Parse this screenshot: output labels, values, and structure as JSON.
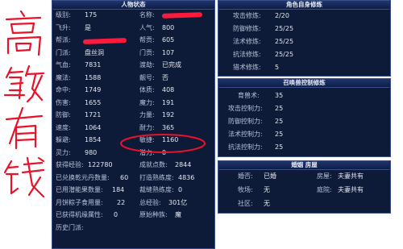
{
  "char_panel": {
    "title": "人物状态",
    "left": [
      {
        "label": "级别:",
        "value": "175"
      },
      {
        "label": "飞升:",
        "value": "是"
      },
      {
        "label": "帮派:",
        "value": ""
      },
      {
        "label": "门派:",
        "value": "盘丝洞"
      },
      {
        "label": "气血:",
        "value": "7831"
      },
      {
        "label": "魔法:",
        "value": "1588"
      },
      {
        "label": "命中:",
        "value": "1749"
      },
      {
        "label": "伤害:",
        "value": "1655"
      },
      {
        "label": "防御:",
        "value": "1721"
      },
      {
        "label": "速度:",
        "value": "1064"
      },
      {
        "label": "躲避:",
        "value": "1854"
      },
      {
        "label": "灵力:",
        "value": "980"
      },
      {
        "label": "获得经验:",
        "value": "122780"
      },
      {
        "label": "已兑换乾元丹数量:",
        "value": "60"
      },
      {
        "label": "已用潜能果数量:",
        "value": "184"
      },
      {
        "label": "月饼粽子食用量:",
        "value": "22"
      },
      {
        "label": "已获得机缘属性:",
        "value": "0"
      },
      {
        "label": "历史门派:",
        "value": ""
      }
    ],
    "right": [
      {
        "label": "名称:",
        "value": ""
      },
      {
        "label": "人气:",
        "value": "800"
      },
      {
        "label": "帮贡:",
        "value": "605"
      },
      {
        "label": "门贡:",
        "value": "107"
      },
      {
        "label": "渡劫:",
        "value": "已完成"
      },
      {
        "label": "靓号:",
        "value": "否"
      },
      {
        "label": "体质:",
        "value": "408"
      },
      {
        "label": "魔力:",
        "value": "191"
      },
      {
        "label": "力量:",
        "value": "192"
      },
      {
        "label": "耐力:",
        "value": "365"
      },
      {
        "label": "敏捷:",
        "value": "1160"
      },
      {
        "label": "潜力:",
        "value": "0"
      },
      {
        "label": "成就点数:",
        "value": "2844"
      },
      {
        "label": "打造熟练度:",
        "value": "4836"
      },
      {
        "label": "裁缝熟练度:",
        "value": "0"
      },
      {
        "label": "总经验:",
        "value": "301亿"
      },
      {
        "label": "原始种族:",
        "value": "魔"
      }
    ]
  },
  "self_cultivation": {
    "title": "角色自身修炼",
    "rows": [
      {
        "label": "攻击修炼:",
        "value": "2/20"
      },
      {
        "label": "防御修炼:",
        "value": "25/25"
      },
      {
        "label": "法术修炼:",
        "value": "25/25"
      },
      {
        "label": "抗法修炼:",
        "value": "25/25"
      },
      {
        "label": "猎术修炼:",
        "value": "5"
      }
    ]
  },
  "pet_control": {
    "title": "召唤兽控制修炼",
    "rows": [
      {
        "label": "育兽术:",
        "value": "35"
      },
      {
        "label": "攻击控制力:",
        "value": "25"
      },
      {
        "label": "防御控制力:",
        "value": "25"
      },
      {
        "label": "法术控制力:",
        "value": "25"
      },
      {
        "label": "抗法控制力:",
        "value": "25"
      }
    ]
  },
  "marriage": {
    "title": "婚姻 房屋",
    "rows": [
      [
        {
          "label": "婚否:",
          "value": "已婚"
        },
        {
          "label": "房屋:",
          "value": "夫妻共有"
        }
      ],
      [
        {
          "label": "牧场:",
          "value": "无"
        },
        {
          "label": "庭院:",
          "value": "夫妻共有"
        }
      ],
      [
        {
          "label": "社区:",
          "value": "无"
        }
      ]
    ]
  },
  "handwriting": {
    "text": "高敏有钱"
  }
}
